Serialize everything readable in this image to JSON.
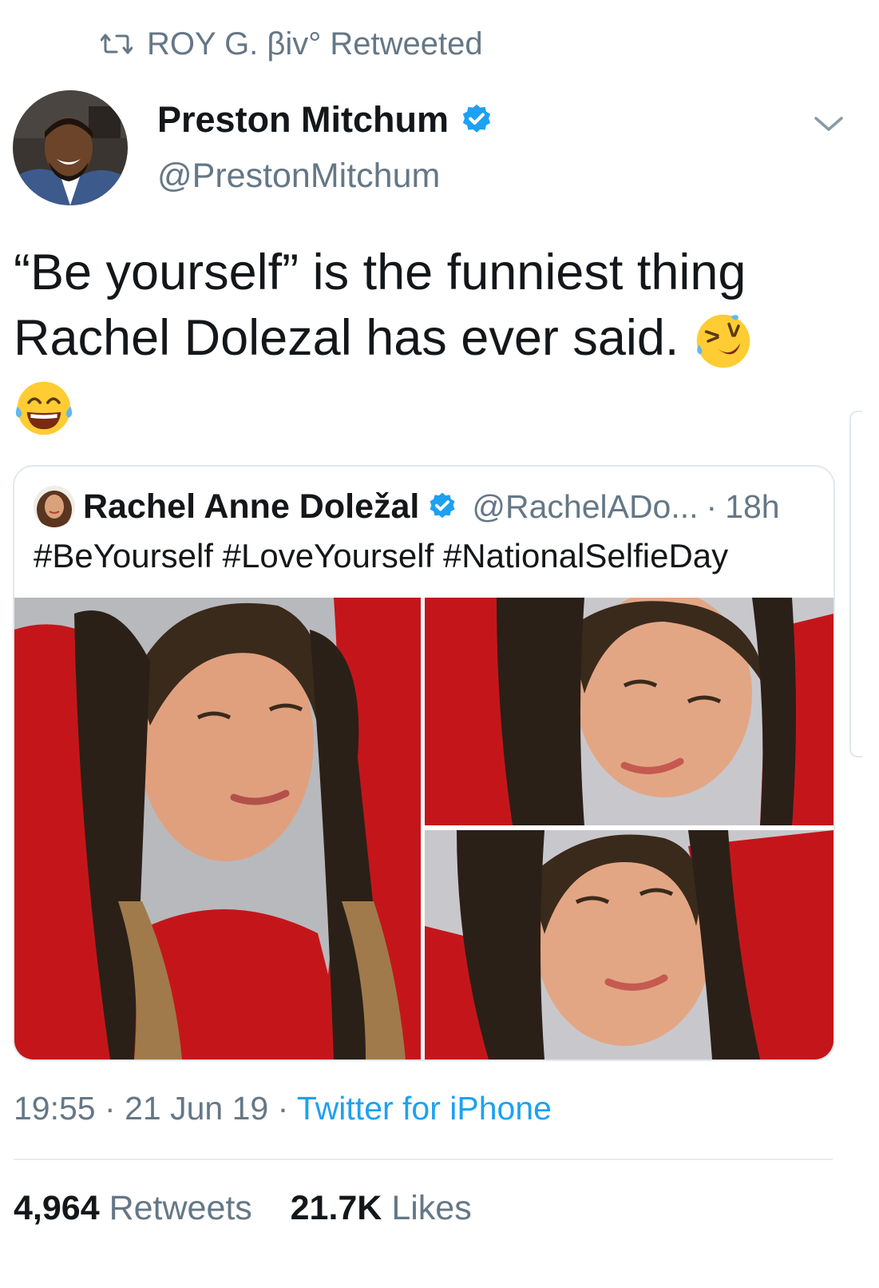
{
  "retweet": {
    "label": "ROY G. βiv° Retweeted"
  },
  "author": {
    "name": "Preston Mitchum",
    "handle": "@PrestonMitchum",
    "verified": true
  },
  "tweet": {
    "line1": "“Be yourself” is the funniest thing",
    "line2": "Rachel Dolezal has ever said.",
    "emojis": [
      "rolling-on-floor-laughing",
      "tears-of-joy"
    ]
  },
  "quote": {
    "name": "Rachel Anne Doležal",
    "handle": "@RachelADo...",
    "separator": "·",
    "time": "18h",
    "text": "#BeYourself #LoveYourself #NationalSelfieDay",
    "photo_count": 3
  },
  "meta": {
    "time": "19:55",
    "sep1": "·",
    "date": "21 Jun 19",
    "sep2": "·",
    "source": "Twitter for iPhone"
  },
  "stats": {
    "retweets_count": "4,964",
    "retweets_label": "Retweets",
    "likes_count": "21.7K",
    "likes_label": "Likes"
  },
  "colors": {
    "link": "#1da1f2",
    "secondary_text": "#657786",
    "primary_text": "#14171a",
    "border": "#e1e8ed"
  }
}
